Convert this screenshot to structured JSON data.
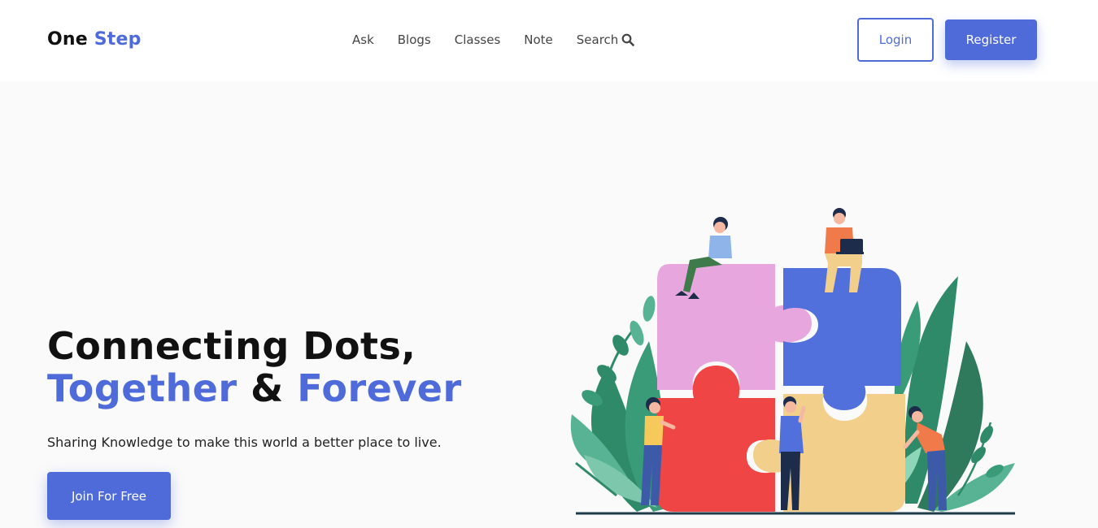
{
  "header": {
    "logo": {
      "part1": "One",
      "part2": "Step"
    },
    "nav": [
      {
        "label": "Ask"
      },
      {
        "label": "Blogs"
      },
      {
        "label": "Classes"
      },
      {
        "label": "Note"
      },
      {
        "label": "Search",
        "icon": "search-icon"
      }
    ],
    "login_label": "Login",
    "register_label": "Register"
  },
  "hero": {
    "title_line1": "Connecting Dots,",
    "title_word1": "Together",
    "title_amp": "&",
    "title_word2": "Forever",
    "subtitle": "Sharing Knowledge to make this world a better place to live.",
    "cta_label": "Join For Free"
  },
  "colors": {
    "accent": "#4f6bd9",
    "puzzle_pink": "#e8a6de",
    "puzzle_blue": "#5170dc",
    "puzzle_red": "#f04545",
    "puzzle_yellow": "#f2d08c",
    "leaf_green": "#2f8a6a"
  }
}
